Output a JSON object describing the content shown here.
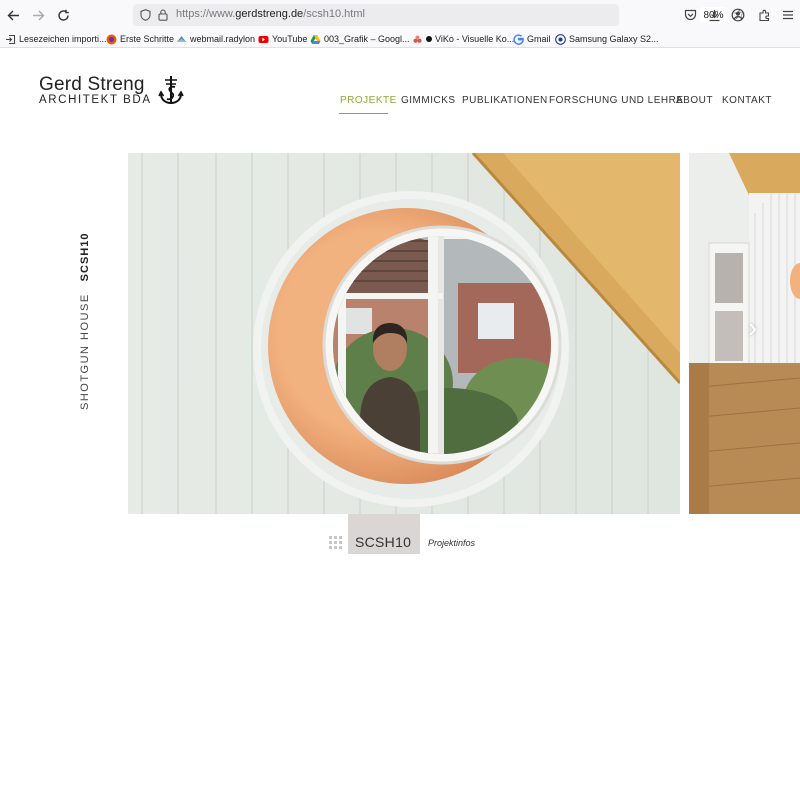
{
  "browser": {
    "url_prefix": "https://www.",
    "url_domain": "gerdstreng.de",
    "url_path": "/scsh10.html",
    "zoom": "80%",
    "bookmarks": [
      {
        "label": "Lesezeichen importi..."
      },
      {
        "label": "Erste Schritte"
      },
      {
        "label": "webmail.radylon"
      },
      {
        "label": "YouTube"
      },
      {
        "label": "003_Grafik – Googl..."
      },
      {
        "label": "ViKo - Visuelle Ko..."
      },
      {
        "label": "Gmail"
      },
      {
        "label": "Samsung Galaxy S2..."
      }
    ]
  },
  "site": {
    "name": "Gerd Streng",
    "subtitle": "ARCHITEKT BDA",
    "nav": [
      {
        "label": "PROJEKTE",
        "active": true
      },
      {
        "label": "GIMMICKS",
        "active": false
      },
      {
        "label": "PUBLIKATIONEN",
        "active": false
      },
      {
        "label": "FORSCHUNG UND LEHRE",
        "active": false
      },
      {
        "label": "ABOUT",
        "active": false
      },
      {
        "label": "KONTAKT",
        "active": false
      }
    ],
    "accent_color": "#8cab2a"
  },
  "project": {
    "title": "SHOTGUN HOUSE",
    "code": "SCSH10",
    "tab_code": "SCSH10",
    "infos_label": "Projektinfos"
  }
}
